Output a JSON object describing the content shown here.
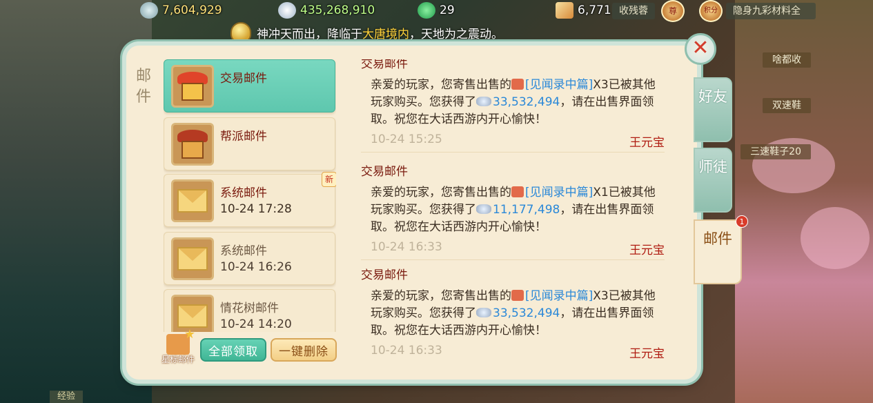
{
  "top_resources": [
    {
      "name": "xian-yu",
      "value": "7,604,929"
    },
    {
      "name": "silver",
      "value": "435,268,910"
    },
    {
      "name": "jade",
      "value": "29"
    },
    {
      "name": "voucher",
      "value": "6,771"
    }
  ],
  "top_right": {
    "tag1": "收残蓉",
    "badge1": "尊",
    "badge2": "积分",
    "tag2": "隐身九彩材料全"
  },
  "side_tags": [
    "啥都收",
    "双速鞋",
    "三速鞋子20"
  ],
  "announcement": {
    "prefix": "神冲天而出，降临于",
    "highlight": "大唐境内",
    "suffix": "，天地为之震动。"
  },
  "panel": {
    "title": "邮件",
    "close_label": "✕"
  },
  "mail_list": [
    {
      "title": "交易邮件",
      "date": "",
      "active": true,
      "is_new": false,
      "icon": "shop"
    },
    {
      "title": "帮派邮件",
      "date": "",
      "active": false,
      "is_new": false,
      "icon": "guild-house"
    },
    {
      "title": "系统邮件",
      "date": "10-24 17:28",
      "active": false,
      "is_new": true,
      "icon": "envelope"
    },
    {
      "title": "系统邮件",
      "date": "10-24 16:26",
      "active": false,
      "is_new": false,
      "icon": "envelope"
    },
    {
      "title": "情花树邮件",
      "date": "10-24 14:20",
      "active": false,
      "is_new": false,
      "icon": "envelope"
    }
  ],
  "new_tag": "新",
  "star_mail_label": "星标邮件",
  "buttons": {
    "collect_all": "全部领取",
    "delete_all": "一键删除"
  },
  "messages": [
    {
      "title": "交易邮件",
      "text_a": "亲爱的玩家，您寄售出售的",
      "link": "[见闻录中篇]",
      "text_b": "X3已被其他玩家购买。您获得了",
      "amount": "33,532,494",
      "text_c": "，请在出售界面领取。祝您在大话西游内开心愉快！",
      "time": "10-24 15:25",
      "sender": "王元宝"
    },
    {
      "title": "交易邮件",
      "text_a": "亲爱的玩家，您寄售出售的",
      "link": "[见闻录中篇]",
      "text_b": "X1已被其他玩家购买。您获得了",
      "amount": "11,177,498",
      "text_c": "，请在出售界面领取。祝您在大话西游内开心愉快！",
      "time": "10-24 16:33",
      "sender": "王元宝"
    },
    {
      "title": "交易邮件",
      "text_a": "亲爱的玩家，您寄售出售的",
      "link": "[见闻录中篇]",
      "text_b": "X3已被其他玩家购买。您获得了",
      "amount": "33,532,494",
      "text_c": "，请在出售界面领取。祝您在大话西游内开心愉快！",
      "time": "10-24 16:33",
      "sender": "王元宝"
    }
  ],
  "right_tabs": [
    {
      "label": "好友",
      "active": false,
      "badge": ""
    },
    {
      "label": "师徒",
      "active": false,
      "badge": ""
    },
    {
      "label": "邮件",
      "active": true,
      "badge": "1"
    }
  ],
  "bottom_left_label": "经验",
  "colors": {
    "accent_teal": "#5ec7ae",
    "panel_bg": "#f7ecd5",
    "title_red": "#7a1a0e",
    "link_blue": "#2a88d8",
    "sender_red": "#b01c12"
  }
}
